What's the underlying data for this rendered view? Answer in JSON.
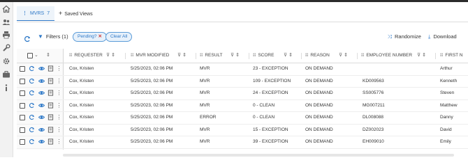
{
  "tabs": {
    "mvrs": {
      "label": "MVRS",
      "count": "7"
    },
    "saved_views": {
      "label": "Saved Views"
    }
  },
  "toolbar": {
    "filters_label": "Filters (1)",
    "pending_chip": "Pending?",
    "clear_all": "Clear All",
    "randomize": "Randomize",
    "download": "Download"
  },
  "columns": {
    "requester": "REQUESTER",
    "mvr_modified": "MVR MODIFIED",
    "result": "RESULT",
    "score": "SCORE",
    "reason": "REASON",
    "employee_number": "EMPLOYEE NUMBER",
    "first_name": "FIRST N"
  },
  "rows": [
    {
      "requester": "Cox, Kristen",
      "modified": "5/25/2023, 02:06 PM",
      "result": "MVR",
      "score": "23 - EXCEPTION",
      "reason": "ON DEMAND",
      "employee": "",
      "first": "Arthur"
    },
    {
      "requester": "Cox, Kristen",
      "modified": "5/25/2023, 02:06 PM",
      "result": "MVR",
      "score": "109 - EXCEPTION",
      "reason": "ON DEMAND",
      "employee": "KD009563",
      "first": "Kenneth"
    },
    {
      "requester": "Cox, Kristen",
      "modified": "5/25/2023, 02:06 PM",
      "result": "MVR",
      "score": "24 - EXCEPTION",
      "reason": "ON DEMAND",
      "employee": "SS005776",
      "first": "Steven"
    },
    {
      "requester": "Cox, Kristen",
      "modified": "5/25/2023, 02:06 PM",
      "result": "MVR",
      "score": "0 - CLEAN",
      "reason": "ON DEMAND",
      "employee": "MG007211",
      "first": "Matthew"
    },
    {
      "requester": "Cox, Kristen",
      "modified": "5/25/2023, 02:06 PM",
      "result": "ERROR",
      "score": "0 - CLEAN",
      "reason": "ON DEMAND",
      "employee": "DL008088",
      "first": "Danny"
    },
    {
      "requester": "Cox, Kristen",
      "modified": "5/25/2023, 02:06 PM",
      "result": "MVR",
      "score": "15 - EXCEPTION",
      "reason": "ON DEMAND",
      "employee": "DZ002023",
      "first": "David"
    },
    {
      "requester": "Cox, Kristen",
      "modified": "5/25/2023, 02:06 PM",
      "result": "MVR",
      "score": "39 - EXCEPTION",
      "reason": "ON DEMAND",
      "employee": "EH009010",
      "first": "Emily"
    }
  ],
  "icons": {
    "sidebar": [
      "home-icon",
      "users-icon",
      "print-icon",
      "wrench-icon",
      "gear-icon",
      "briefcase-icon",
      "info-icon"
    ],
    "row_actions": [
      "checkbox",
      "refresh-icon",
      "eye-icon",
      "notes-icon",
      "more-vert-icon"
    ]
  },
  "colors": {
    "accent": "#2d78c7",
    "chip_remove": "#d2322d",
    "topbar": "#2b2b2b"
  }
}
